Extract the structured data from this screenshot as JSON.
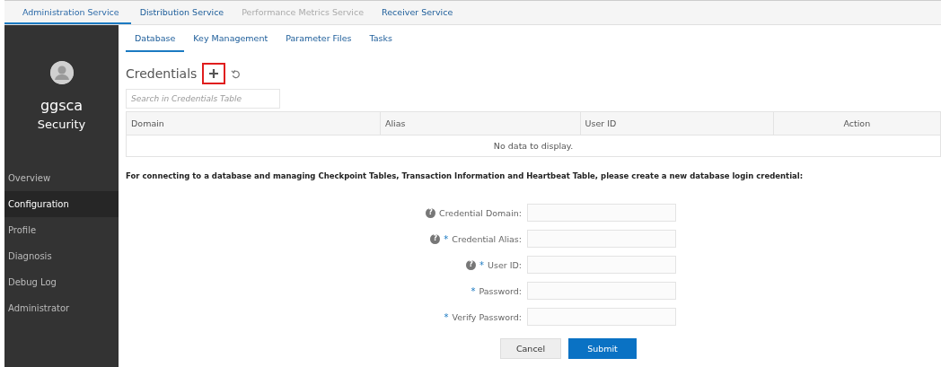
{
  "service_tabs": [
    {
      "label": "Administration Service",
      "selected": true,
      "disabled": false
    },
    {
      "label": "Distribution Service",
      "selected": false,
      "disabled": false
    },
    {
      "label": "Performance Metrics Service",
      "selected": false,
      "disabled": true
    },
    {
      "label": "Receiver Service",
      "selected": false,
      "disabled": false
    }
  ],
  "sidebar": {
    "user": "ggsca",
    "section": "Security",
    "items": [
      {
        "label": "Overview",
        "selected": false
      },
      {
        "label": "Configuration",
        "selected": true
      },
      {
        "label": "Profile",
        "selected": false
      },
      {
        "label": "Diagnosis",
        "selected": false
      },
      {
        "label": "Debug Log",
        "selected": false
      },
      {
        "label": "Administrator",
        "selected": false
      }
    ]
  },
  "sub_tabs": [
    {
      "label": "Database",
      "selected": true
    },
    {
      "label": "Key Management",
      "selected": false
    },
    {
      "label": "Parameter Files",
      "selected": false
    },
    {
      "label": "Tasks",
      "selected": false
    }
  ],
  "credentials": {
    "title": "Credentials",
    "add_highlighted": true,
    "search": {
      "placeholder": "Search in Credentials Table"
    },
    "columns": [
      {
        "label": "Domain"
      },
      {
        "label": "Alias"
      },
      {
        "label": "User ID"
      },
      {
        "label": "Action"
      }
    ],
    "empty_message": "No data to display."
  },
  "instruction": "For connecting to a database and managing Checkpoint Tables, Transaction Information and Heartbeat Table, please create a new database login credential:",
  "form": {
    "fields": [
      {
        "label": "Credential Domain:",
        "help_icon": "?"
      },
      {
        "label": "Credential Alias:",
        "help_icon": "?",
        "required_mark": "*"
      },
      {
        "label": "User ID:",
        "help_icon": "?",
        "required_mark": "*"
      },
      {
        "label": "Password:",
        "required_mark": "*"
      },
      {
        "label": "Verify Password:",
        "required_mark": "*"
      }
    ],
    "buttons": [
      {
        "label": "Cancel",
        "kind": "secondary"
      },
      {
        "label": "Submit",
        "kind": "primary"
      }
    ]
  }
}
